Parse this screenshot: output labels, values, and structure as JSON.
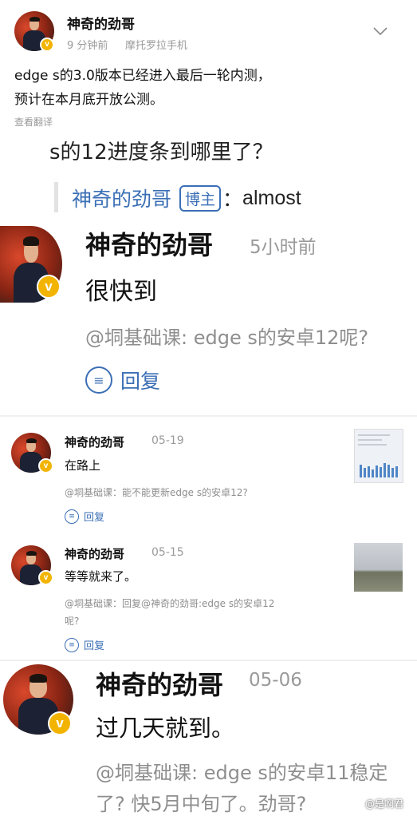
{
  "post": {
    "author": "神奇的劲哥",
    "time": "9 分钟前",
    "device": "摩托罗拉手机",
    "line1": "edge  s的3.0版本已经进入最后一轮内测，",
    "line2": "预计在本月底开放公测。",
    "translate": "查看翻译"
  },
  "question": {
    "text": "s的12进度条到哪里了？",
    "reply_author": "神奇的劲哥",
    "badge": "博主",
    "reply_sep": "：",
    "reply_text": "almost"
  },
  "comments": [
    {
      "author": "神奇的劲哥",
      "time": "5小时前",
      "text": "很快到",
      "quote": "@垌基础课: edge  s的安卓12呢?",
      "reply_label": "回复"
    },
    {
      "author": "神奇的劲哥",
      "time": "05-19",
      "text": "在路上",
      "quote": "@垌基础课：能不能更新edge  s的安卓12?",
      "reply_label": "回复"
    },
    {
      "author": "神奇的劲哥",
      "time": "05-15",
      "text": "等等就来了。",
      "quote_line1": "@垌基础课：回复@神奇的劲哥:edge  s的安卓12",
      "quote_line2": "呢?",
      "reply_label": "回复"
    },
    {
      "author": "神奇的劲哥",
      "time": "05-06",
      "text": "过几天就到。",
      "quote_line1": "@垌基础课: edge  s的安卓11稳定",
      "quote_line2": "了? 快5月中旬了。劲哥?"
    }
  ],
  "watermark": "@是啊君",
  "icons": {
    "verified": "verified-v-icon",
    "chevron": "chevron-down-icon",
    "reply": "reply-bubble-icon"
  },
  "colors": {
    "accent_blue": "#3b6fb5",
    "badge_gold": "#f2b400",
    "muted": "#9a9a9a"
  }
}
